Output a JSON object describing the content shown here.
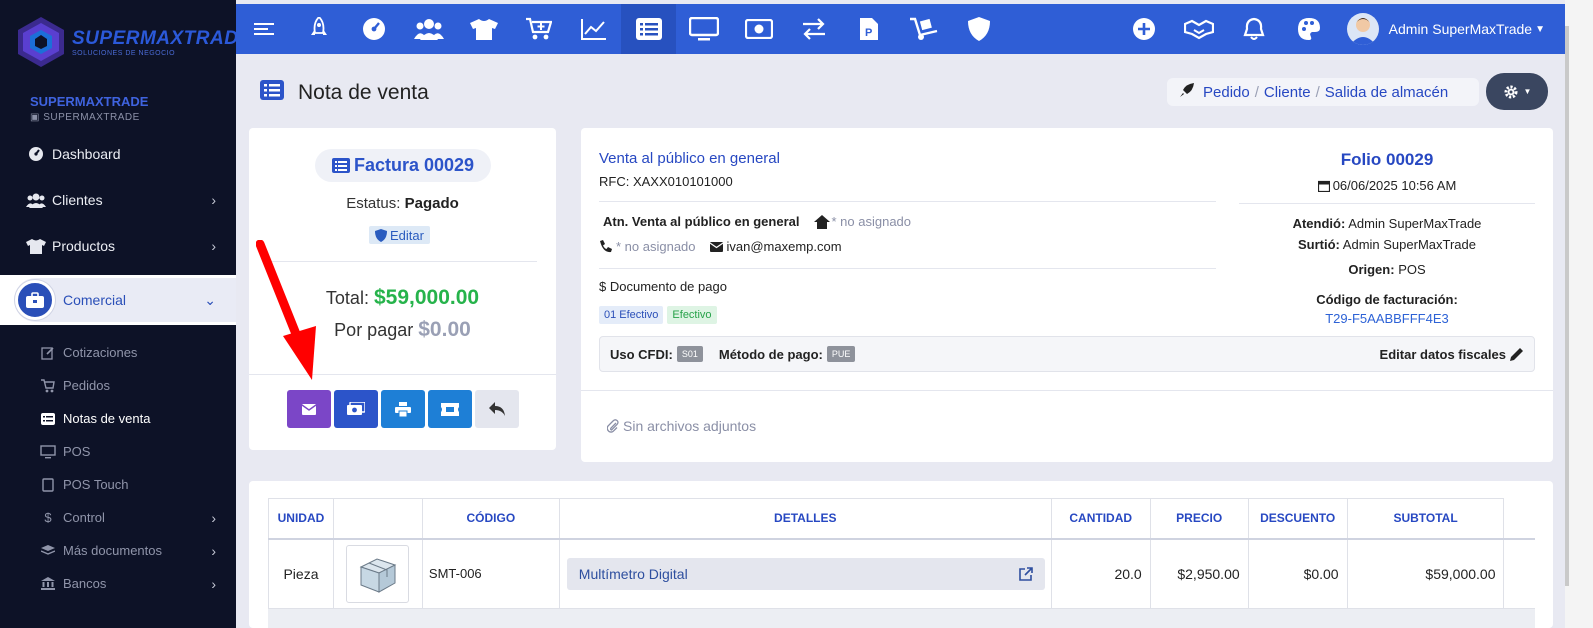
{
  "logo": {
    "name": "SUPERMAXTRADE",
    "sub": "SOLUCIONES DE NEGOCIO"
  },
  "brand": {
    "name": "SUPERMAXTRADE",
    "sub": "SUPERMAXTRADE"
  },
  "sidebar": {
    "items": [
      {
        "label": "Dashboard",
        "icon": "dashboard-icon"
      },
      {
        "label": "Clientes",
        "icon": "users-icon"
      },
      {
        "label": "Productos",
        "icon": "shirt-icon"
      }
    ],
    "active": {
      "label": "Comercial",
      "icon": "briefcase-icon"
    },
    "sub_items": [
      {
        "label": "Cotizaciones",
        "icon": "edit-icon"
      },
      {
        "label": "Pedidos",
        "icon": "cart-icon"
      },
      {
        "label": "Notas de venta",
        "icon": "list-icon"
      },
      {
        "label": "POS",
        "icon": "monitor-icon"
      },
      {
        "label": "POS Touch",
        "icon": "tablet-icon"
      },
      {
        "label": "Control",
        "icon": "dollar-icon"
      },
      {
        "label": "Más documentos",
        "icon": "layers-icon"
      },
      {
        "label": "Bancos",
        "icon": "bank-icon"
      }
    ]
  },
  "topbar": {
    "user_name": "Admin SuperMaxTrade",
    "color": "#2f5ed6"
  },
  "page": {
    "title": "Nota de venta",
    "crumbs": [
      "Pedido",
      "Cliente",
      "Salida de almacén"
    ]
  },
  "invoice": {
    "label": "Factura 00029",
    "status_label": "Estatus:",
    "status_value": "Pagado",
    "edit_label": "Editar",
    "total_label": "Total:",
    "total_value": "$59,000.00",
    "due_label": "Por pagar",
    "due_value": "$0.00"
  },
  "customer": {
    "name": "Venta al público en general",
    "rfc": "RFC: XAXX010101000",
    "atn": "Atn. Venta al público en general",
    "address": "* no asignado",
    "phone": "* no asignado",
    "email": "ivan@maxemp.com",
    "doc_pago": "Documento de pago",
    "badge1": "01 Efectivo",
    "badge2": "Efectivo",
    "uso_cfdi_label": "Uso CFDI:",
    "uso_cfdi_value": "S01",
    "metodo_label": "Método de pago:",
    "metodo_value": "PUE",
    "edit_fiscal": "Editar datos fiscales",
    "attachments": "Sin archivos adjuntos"
  },
  "folio": {
    "label": "Folio 00029",
    "date": "06/06/2025 10:56 AM",
    "atendio_label": "Atendió:",
    "atendio": "Admin SuperMaxTrade",
    "surtio_label": "Surtió:",
    "surtio": "Admin SuperMaxTrade",
    "origen_label": "Origen:",
    "origen": "POS",
    "fact_label": "Código de facturación:",
    "fact_code": "T29-F5AABBFFF4E3"
  },
  "table": {
    "headers": [
      "UNIDAD",
      "",
      "CÓDIGO",
      "DETALLES",
      "CANTIDAD",
      "PRECIO",
      "DESCUENTO",
      "SUBTOTAL"
    ],
    "rows": [
      {
        "unidad": "Pieza",
        "codigo": "SMT-006",
        "detalle": "Multímetro Digital",
        "cantidad": "20.0",
        "precio": "$2,950.00",
        "descuento": "$0.00",
        "subtotal": "$59,000.00"
      }
    ]
  },
  "colors": {
    "accent": "#2f5ed6",
    "sidebar": "#0d1227",
    "mail_button": "#7b46c7",
    "green": "#26b34b",
    "arrow": "#ff0000"
  }
}
